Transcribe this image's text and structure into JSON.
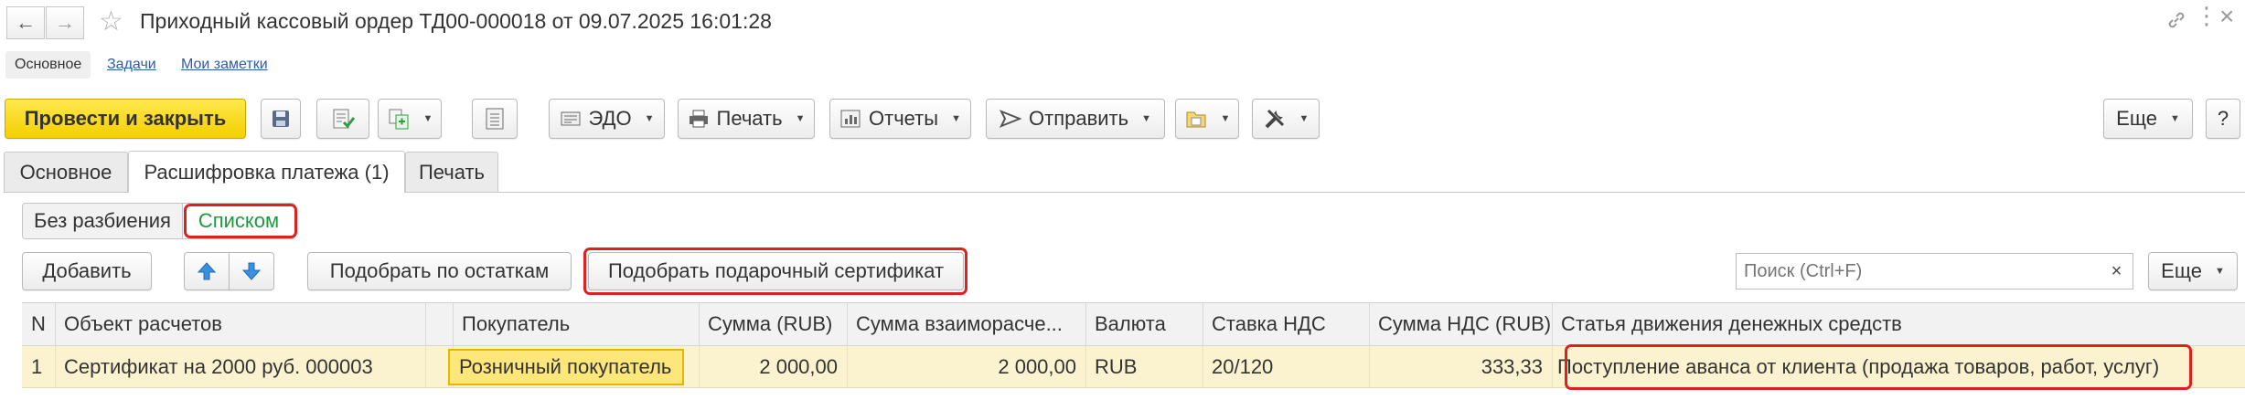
{
  "window": {
    "title": "Приходный кассовый ордер ТД00-000018 от 09.07.2025 16:01:28"
  },
  "top_links": [
    "Основное",
    "Задачи",
    "Мои заметки"
  ],
  "toolbar": {
    "post_close": "Провести и закрыть",
    "edo": "ЭДО",
    "print": "Печать",
    "reports": "Отчеты",
    "send": "Отправить",
    "more": "Еще",
    "help": "?"
  },
  "tabs": [
    "Основное",
    "Расшифровка платежа (1)",
    "Печать"
  ],
  "view_mode": {
    "options": [
      "Без разбиения",
      "Списком"
    ],
    "selected": "Списком"
  },
  "table_toolbar": {
    "add": "Добавить",
    "pick_by_balance": "Подобрать по остаткам",
    "pick_certificate": "Подобрать подарочный сертификат",
    "search_placeholder": "Поиск (Ctrl+F)",
    "search_clear": "×",
    "more": "Еще"
  },
  "table": {
    "columns": [
      "N",
      "Объект расчетов",
      "",
      "Покупатель",
      "Сумма (RUB)",
      "Сумма взаиморасче...",
      "Валюта",
      "Ставка НДС",
      "Сумма НДС (RUB)",
      "Статья движения денежных средств"
    ],
    "rows": [
      {
        "n": "1",
        "object": "Сертификат на 2000 руб. 000003",
        "buyer": "Розничный покупатель",
        "amount": "2 000,00",
        "settlement_amount": "2 000,00",
        "currency": "RUB",
        "vat_rate": "20/120",
        "vat_amount": "333,33",
        "cash_flow_item": "Поступление аванса от клиента (продажа товаров, работ, услуг)"
      }
    ]
  },
  "colors": {
    "primary_button": "#f3cf00",
    "highlight": "#e02020",
    "selected_row": "#fbf3cf",
    "selected_option": "#1e9a3c"
  }
}
